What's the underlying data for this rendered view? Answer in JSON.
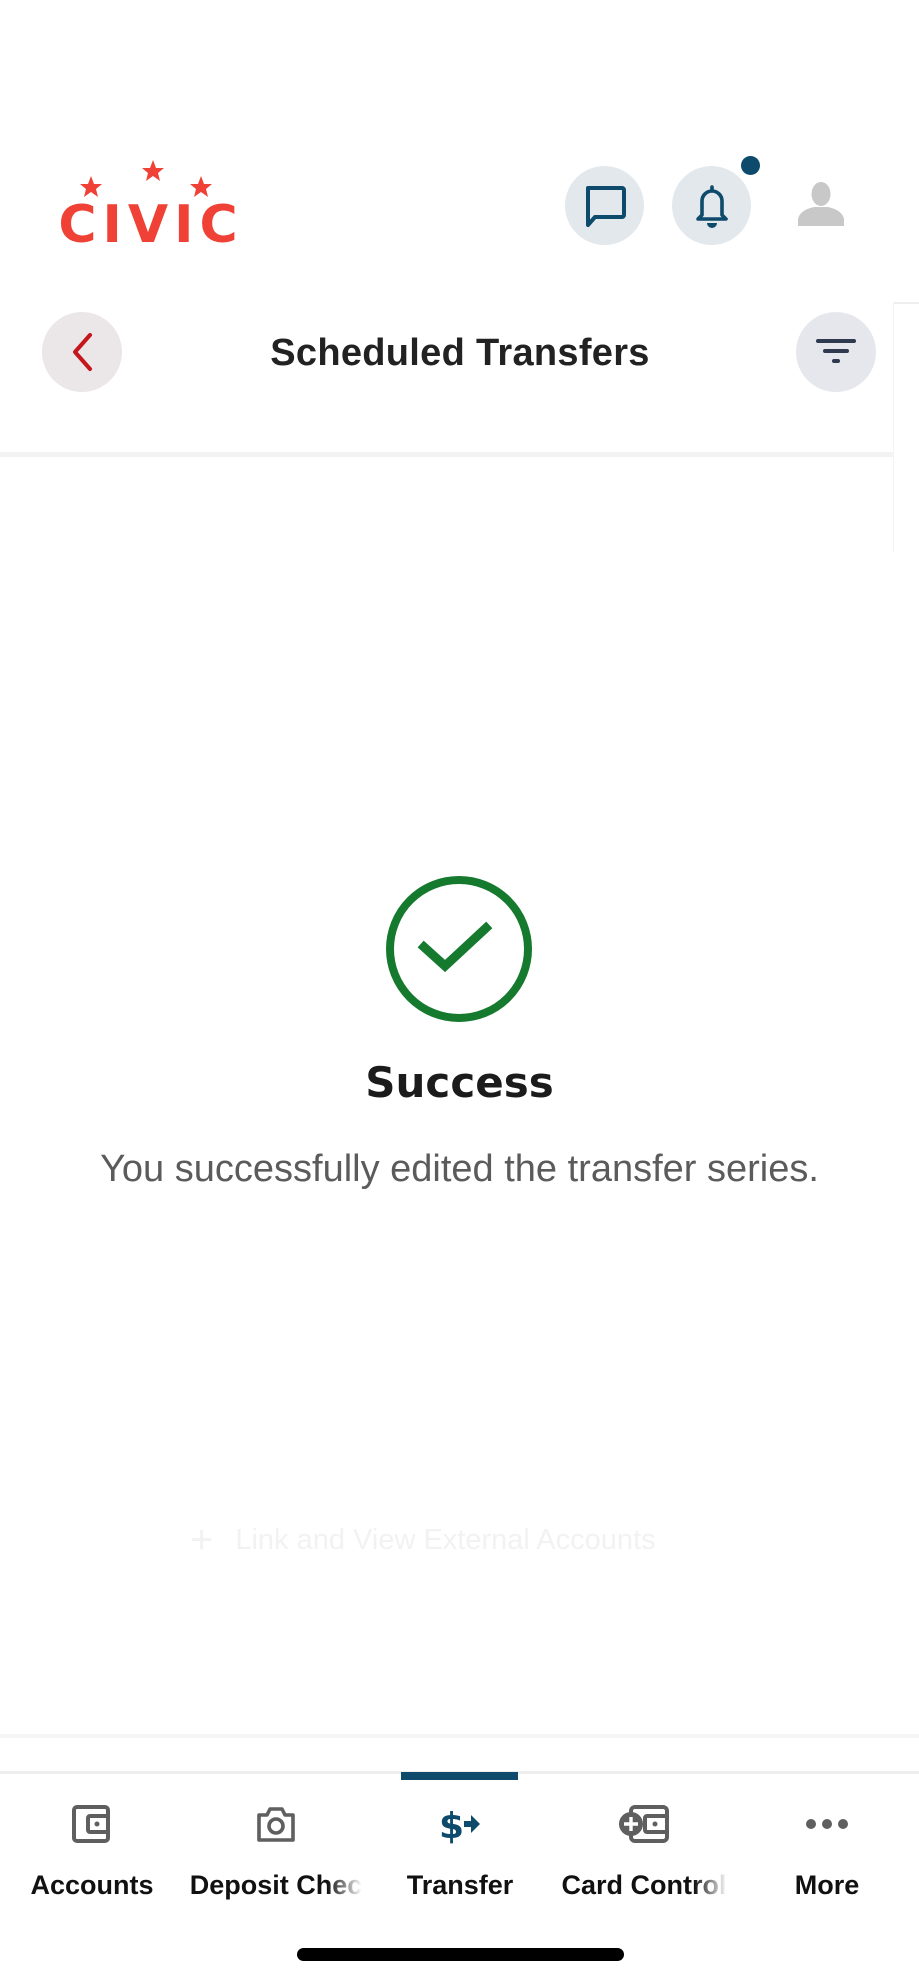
{
  "header": {
    "logo_text": "CIVIC",
    "icons": {
      "messages": "chat-bubble-icon",
      "notifications": "bell-icon",
      "profile": "user-avatar-icon"
    },
    "has_unread_notifications": true
  },
  "page": {
    "title": "Scheduled Transfers",
    "back_icon": "chevron-left-icon",
    "filter_icon": "filter-icon"
  },
  "success": {
    "icon": "check-circle-icon",
    "title": "Success",
    "message": "You successfully edited the transfer series."
  },
  "background_link": {
    "icon": "plus-icon",
    "label": "Link and View External Accounts"
  },
  "bottom_nav": {
    "active": "Transfer",
    "items": [
      {
        "label": "Accounts",
        "icon": "wallet-icon"
      },
      {
        "label": "Deposit Chec",
        "icon": "camera-icon"
      },
      {
        "label": "Transfer",
        "icon": "dollar-transfer-icon"
      },
      {
        "label": "Card Control",
        "icon": "card-control-icon"
      },
      {
        "label": "More",
        "icon": "more-dots-icon"
      }
    ]
  },
  "colors": {
    "brand_red": "#ef4136",
    "accent_navy": "#0d4a6b",
    "success_green": "#157a2e",
    "icon_gray": "#5f5f5f"
  }
}
